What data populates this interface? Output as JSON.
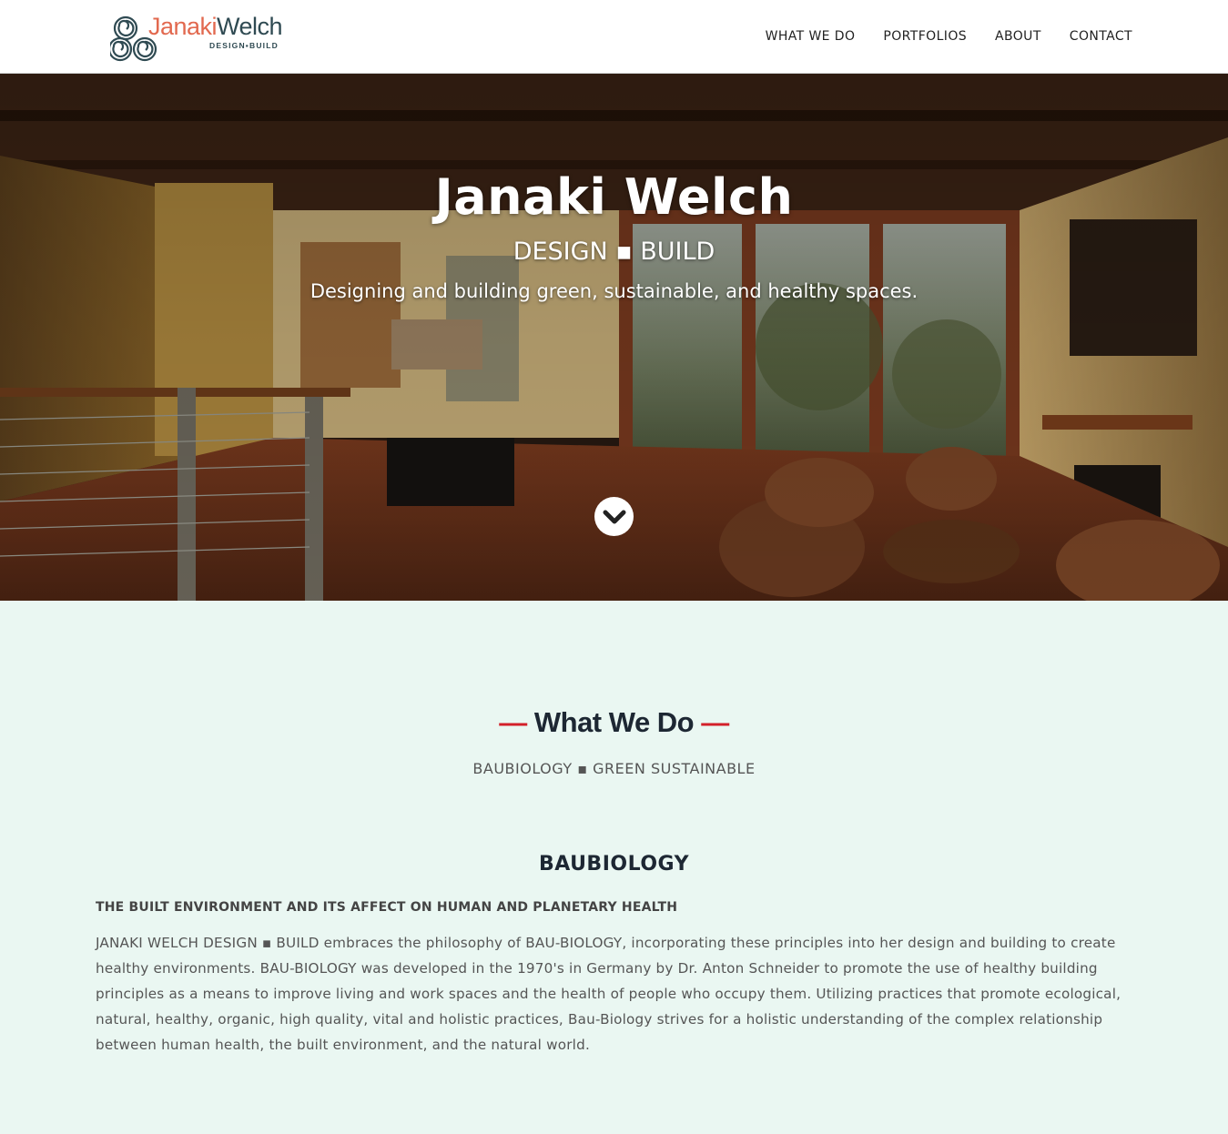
{
  "header": {
    "logo": {
      "first_name": "Janaki",
      "last_name": "Welch",
      "tagline": "DESIGN▪BUILD",
      "colors": {
        "first": "#e2694f",
        "last": "#2f4a52"
      },
      "icon": "triple-spiral-icon"
    },
    "nav": [
      {
        "label": "WHAT WE DO"
      },
      {
        "label": "PORTFOLIOS"
      },
      {
        "label": "ABOUT"
      },
      {
        "label": "CONTACT"
      }
    ]
  },
  "hero": {
    "title": "Janaki Welch",
    "subtitle": "DESIGN ▪ BUILD",
    "tagline": "Designing and building green, sustainable, and healthy spaces.",
    "scroll_icon": "chevron-down-icon",
    "image": "living-room-interior-photo"
  },
  "what_we_do": {
    "dash": "—",
    "title": "What We Do",
    "subtitle": "BAUBIOLOGY ▪ GREEN SUSTAINABLE",
    "accent_color": "#d3202a"
  },
  "baubiology": {
    "heading": "BAUBIOLOGY",
    "caption": "THE BUILT ENVIRONMENT AND ITS AFFECT ON HUMAN AND PLANETARY HEALTH",
    "body": "JANAKI WELCH DESIGN ▪ BUILD embraces the philosophy of BAU-BIOLOGY, incorporating these principles into her design and building to create healthy environments. BAU-BIOLOGY was developed in the 1970's in Germany by Dr. Anton Schneider to promote the use of healthy building principles as a means to improve living and work spaces and the health of people who occupy them. Utilizing practices that promote ecological, natural, healthy, organic, high quality, vital and holistic practices, Bau-Biology strives for a holistic understanding of the complex relationship between human health, the built environment, and the natural world."
  },
  "colors": {
    "page_bg": "#eaf7f2",
    "header_bg": "#ffffff",
    "text_dark": "#1d2733"
  }
}
